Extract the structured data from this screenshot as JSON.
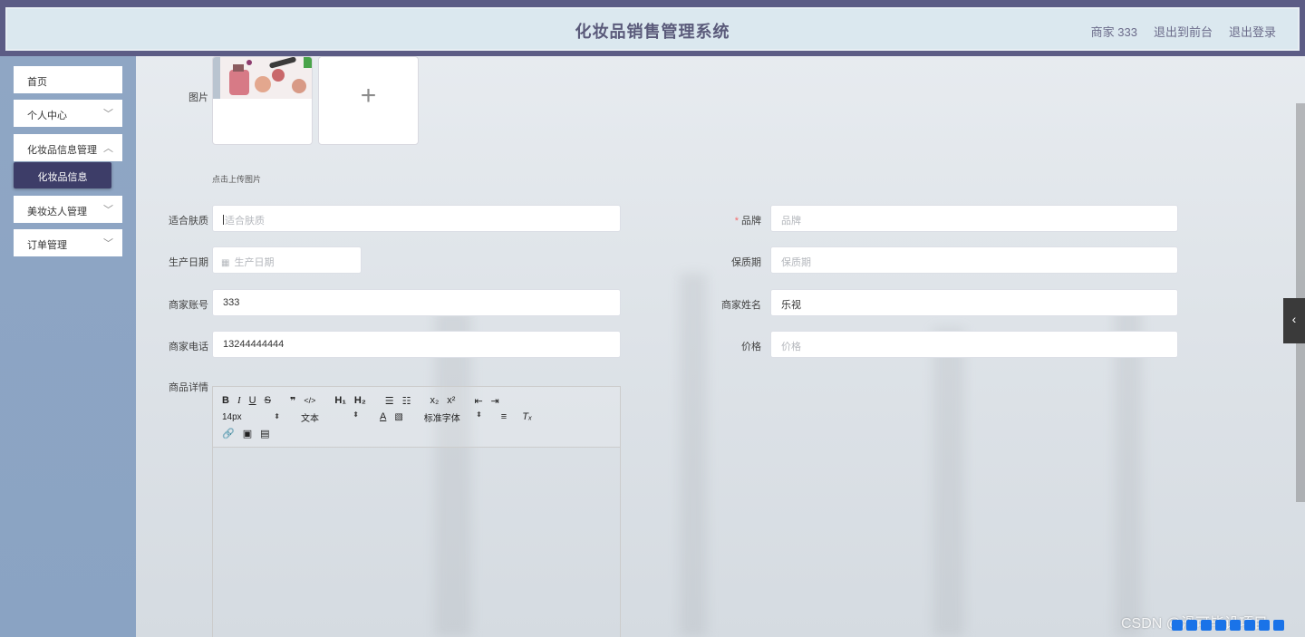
{
  "header": {
    "title": "化妆品销售管理系统",
    "user": "商家 333",
    "back_to_front": "退出到前台",
    "logout": "退出登录"
  },
  "sidebar": {
    "items": [
      {
        "label": "首页",
        "has_submenu": false
      },
      {
        "label": "个人中心",
        "has_submenu": true
      },
      {
        "label": "化妆品信息管理",
        "has_submenu": true
      },
      {
        "label": "美妆达人管理",
        "has_submenu": true
      },
      {
        "label": "订单管理",
        "has_submenu": true
      }
    ],
    "active_sub": "化妆品信息"
  },
  "form": {
    "image_label": "图片",
    "upload_hint": "点击上传图片",
    "skin_type": {
      "label": "适合肤质",
      "placeholder": "适合肤质"
    },
    "brand": {
      "label": "品牌",
      "placeholder": "品牌",
      "required": true
    },
    "production_date": {
      "label": "生产日期",
      "placeholder": "生产日期"
    },
    "shelf_life": {
      "label": "保质期",
      "placeholder": "保质期"
    },
    "merchant_account": {
      "label": "商家账号",
      "value": "333"
    },
    "merchant_name": {
      "label": "商家姓名",
      "value": "乐视"
    },
    "merchant_phone": {
      "label": "商家电话",
      "value": "13244444444"
    },
    "price": {
      "label": "价格",
      "placeholder": "价格"
    },
    "details_label": "商品详情"
  },
  "editor": {
    "font_size": "14px",
    "paragraph": "文本",
    "font_family": "标准字体"
  },
  "watermark": "CSDN @滑可毕设项目",
  "icons": {
    "toolbar_row1": [
      "bold-icon",
      "italic-icon",
      "underline-icon",
      "strike-icon",
      "quote-icon",
      "code-icon",
      "h1-icon",
      "h2-icon",
      "ordered-list-icon",
      "bullet-list-icon",
      "subscript-icon",
      "superscript-icon",
      "indent-decrease-icon",
      "indent-increase-icon"
    ],
    "toolbar_row2": [
      "font-color-icon",
      "background-color-icon",
      "align-icon",
      "clear-format-icon"
    ],
    "toolbar_row3": [
      "link-icon",
      "image-icon",
      "video-icon"
    ]
  },
  "colors": {
    "header_bg": "#dbe8ef",
    "frame": "#5c5c85",
    "sidebar_bg": "#8fa6c4",
    "active_sub": "#3d3d68",
    "required": "#f56c6c"
  }
}
